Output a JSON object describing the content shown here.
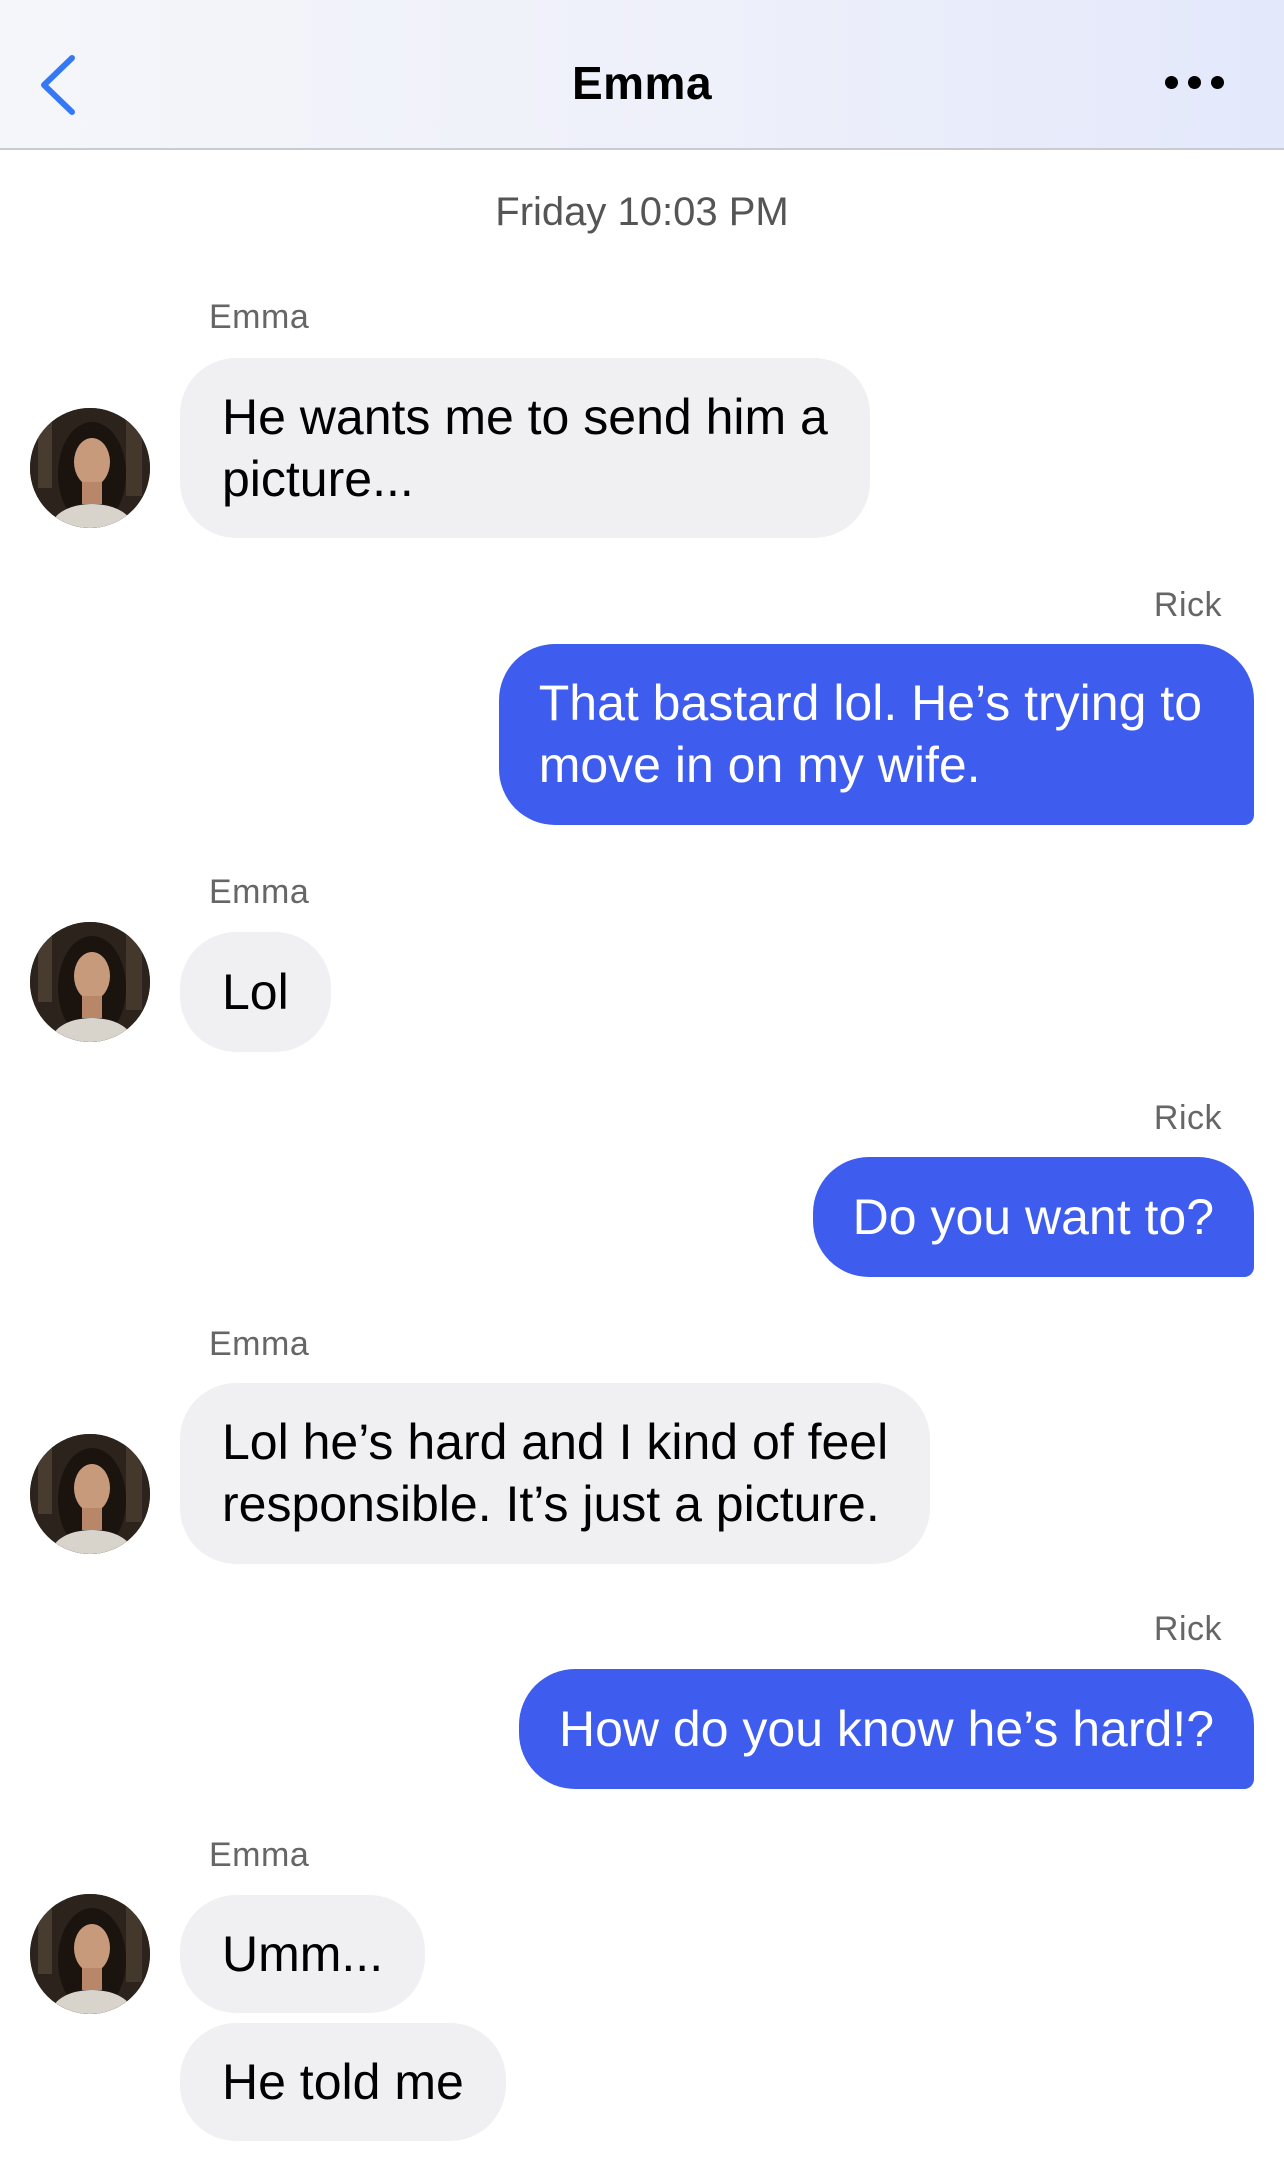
{
  "header": {
    "title": "Emma",
    "back_icon": "chevron-left-icon",
    "more_icon": "more-horizontal-icon",
    "accent_color": "#3478f6"
  },
  "conversation": {
    "timestamp": "Friday 10:03 PM",
    "bubble_in_color": "#f0f0f3",
    "bubble_out_color": "#3e5ced",
    "messages": [
      {
        "sender": "Emma",
        "direction": "incoming",
        "text": "He wants me to send him a\npicture..."
      },
      {
        "sender": "Rick",
        "direction": "outgoing",
        "text": "That bastard lol. He’s trying to\nmove in on my wife."
      },
      {
        "sender": "Emma",
        "direction": "incoming",
        "text": "Lol"
      },
      {
        "sender": "Rick",
        "direction": "outgoing",
        "text": "Do you want to?"
      },
      {
        "sender": "Emma",
        "direction": "incoming",
        "text": "Lol he’s hard and I kind of feel\nresponsible. It’s just a picture."
      },
      {
        "sender": "Rick",
        "direction": "outgoing",
        "text": "How do you know he’s hard!?"
      },
      {
        "sender": "Emma",
        "direction": "incoming",
        "text": "Umm..."
      },
      {
        "sender": "Emma",
        "direction": "incoming",
        "text": "He told me"
      }
    ]
  }
}
